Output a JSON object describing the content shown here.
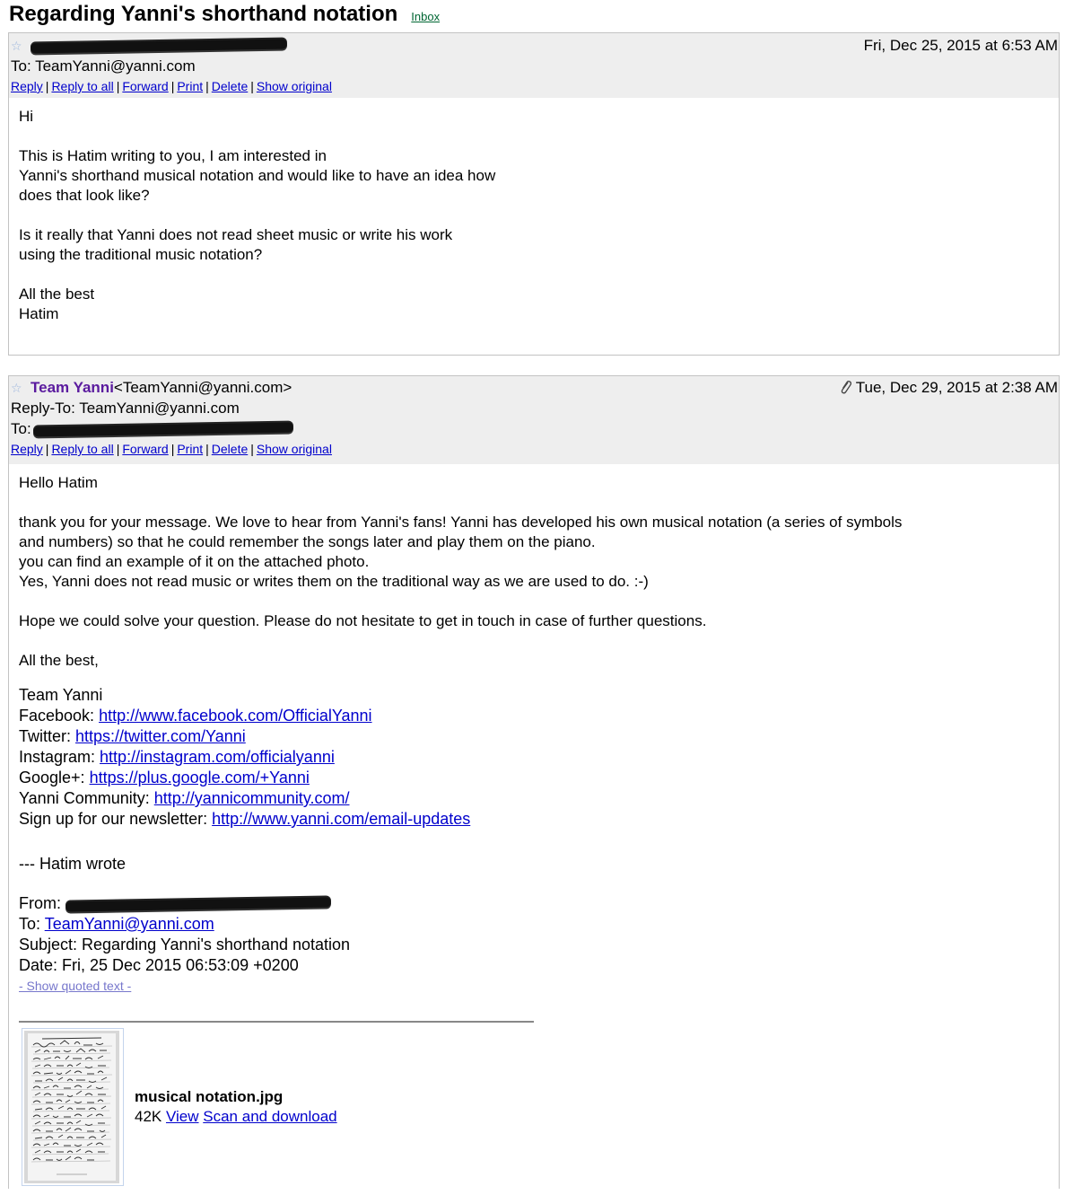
{
  "subject": "Regarding Yanni's shorthand notation",
  "inbox_label": "Inbox",
  "message1": {
    "date": "Fri, Dec 25, 2015 at 6:53 AM",
    "to_line": "To: TeamYanni@yanni.com",
    "actions": [
      "Reply",
      "Reply to all",
      "Forward",
      "Print",
      "Delete",
      "Show original"
    ],
    "body": {
      "greeting": "Hi",
      "p1_l1": "This is Hatim  writing to you, I am interested in",
      "p1_l2": "Yanni's shorthand musical notation and would like to have an idea how",
      "p1_l3": "does that look like?",
      "p2_l1": "Is it really that Yanni does not read sheet music or write his work",
      "p2_l2": "using the traditional music notation?",
      "closing": "All the best",
      "signature": "Hatim"
    }
  },
  "message2": {
    "sender_name": "Team Yanni",
    "sender_email": "<TeamYanni@yanni.com>",
    "date": "Tue, Dec 29, 2015 at 2:38 AM",
    "reply_to": "Reply-To: TeamYanni@yanni.com",
    "to_label": "To:",
    "actions": [
      "Reply",
      "Reply to all",
      "Forward",
      "Print",
      "Delete",
      "Show original"
    ],
    "body": {
      "greeting": "Hello Hatim",
      "p1_l1": "thank you for your message. We love to hear from Yanni's fans! Yanni has developed his own musical notation (a series of symbols",
      "p1_l2": "and numbers) so that he could remember the songs later and play them on the piano.",
      "p1_l3": "you can find an example of it on the attached photo.",
      "p1_l4": "Yes, Yanni does not read music or writes them on the traditional way as we are used to do. :-)",
      "p2": "Hope we could solve your question. Please do not hesitate to get in touch in case of further questions.",
      "closing": "All the best,"
    },
    "signature": {
      "name": "Team Yanni",
      "facebook_label": "Facebook: ",
      "facebook_url": "http://www.facebook.com/OfficialYanni",
      "twitter_label": "Twitter: ",
      "twitter_url": "https://twitter.com/Yanni",
      "instagram_label": "Instagram: ",
      "instagram_url": "http://instagram.com/officialyanni",
      "google_label": "Google+: ",
      "google_url": "https://plus.google.com/+Yanni",
      "community_label": "Yanni Community: ",
      "community_url": "http://yannicommunity.com/",
      "newsletter_label": "Sign up for our newsletter: ",
      "newsletter_url": "http://www.yanni.com/email-updates"
    },
    "quote": {
      "header": "---  Hatim  wrote",
      "from_label": "From: ",
      "to_label": "To: ",
      "to_email": "TeamYanni@yanni.com",
      "subject_line": "Subject: Regarding Yanni's shorthand notation",
      "date_line": "Date: Fri, 25 Dec 2015 06:53:09 +0200",
      "show_quoted": "- Show quoted text -"
    },
    "attachment": {
      "filename": "musical notation.jpg",
      "size": "42K",
      "view_label": "View",
      "download_label": "Scan and download"
    }
  },
  "icons": {
    "star": "star-outline-icon",
    "paperclip": "paperclip-icon"
  }
}
